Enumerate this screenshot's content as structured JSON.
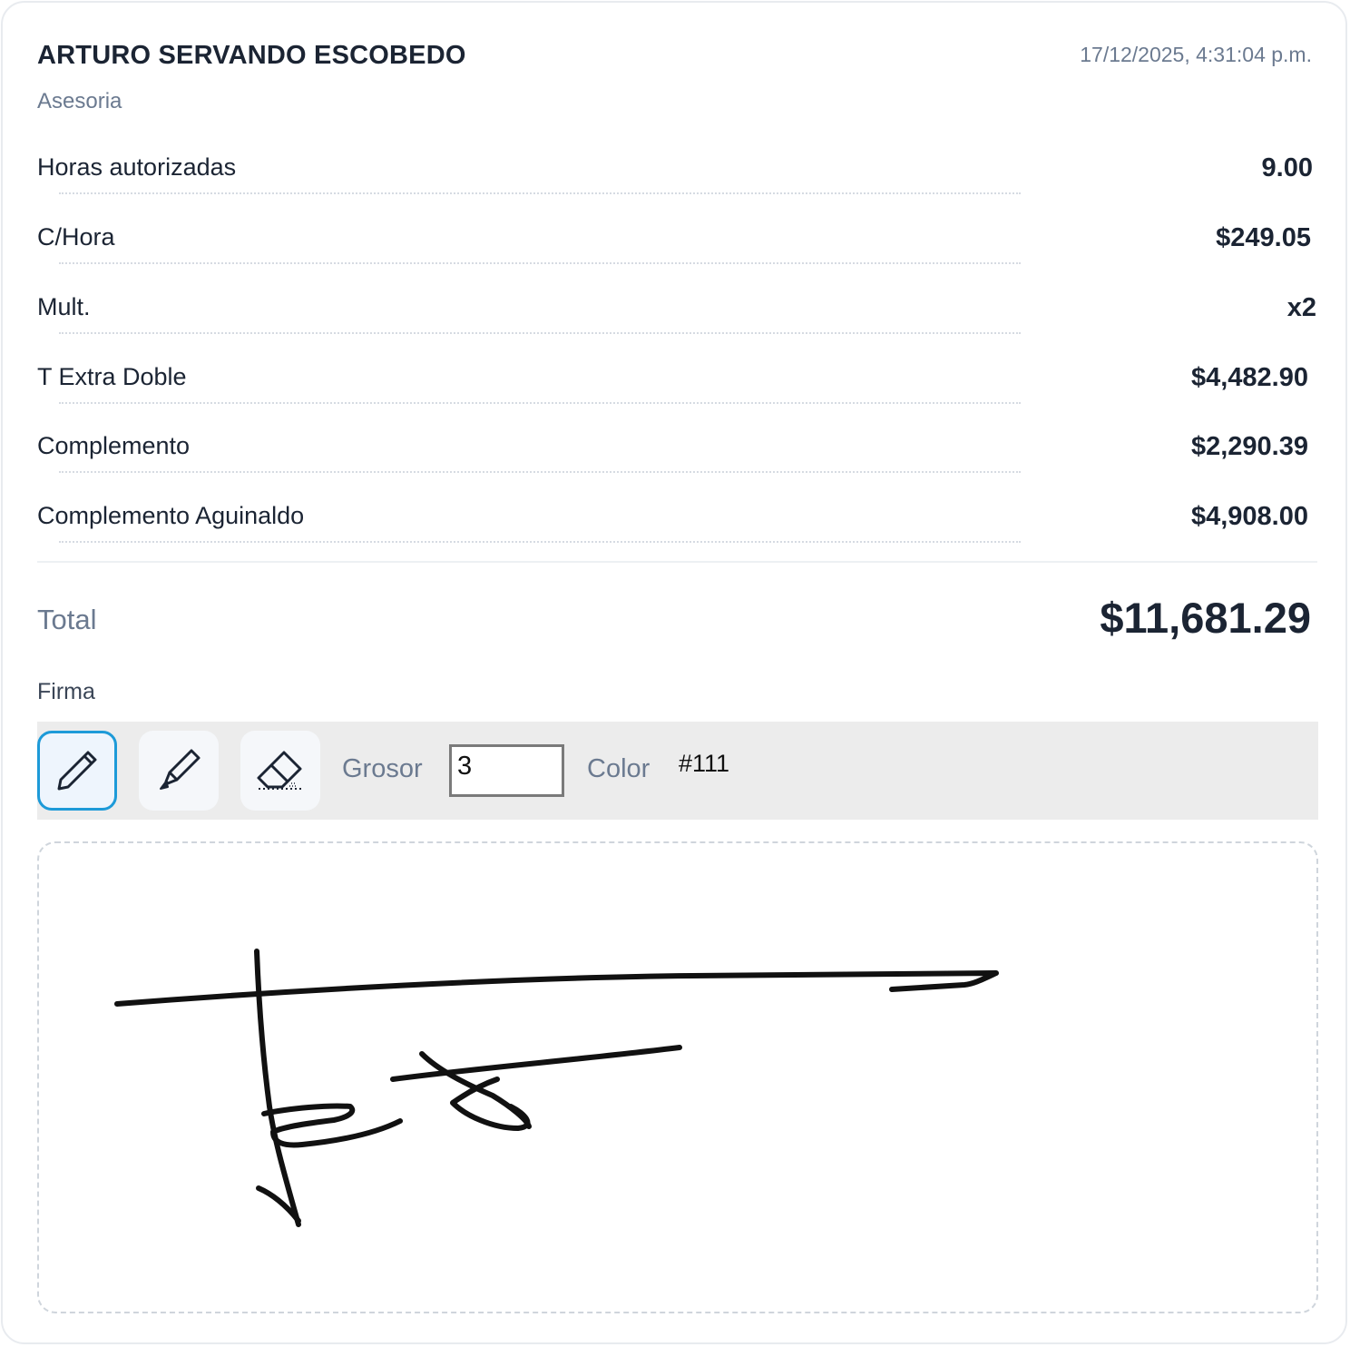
{
  "header": {
    "name": "ARTURO SERVANDO ESCOBEDO",
    "role": "Asesoria",
    "timestamp": "17/12/2025, 4:31:04 p.m."
  },
  "items": [
    {
      "label": "Horas autorizadas",
      "value": "9.00"
    },
    {
      "label": "C/Hora",
      "value": "$249.05"
    },
    {
      "label": "Mult.",
      "value": "x2"
    },
    {
      "label": "T Extra Doble",
      "value": "$4,482.90"
    },
    {
      "label": "Complemento",
      "value": "$2,290.39"
    },
    {
      "label": "Complemento Aguinaldo",
      "value": "$4,908.00"
    }
  ],
  "total": {
    "label": "Total",
    "value": "$11,681.29"
  },
  "signature": {
    "label": "Firma",
    "tools": [
      {
        "icon": "pen-icon",
        "active": true
      },
      {
        "icon": "marker-icon",
        "active": false
      },
      {
        "icon": "eraser-icon",
        "active": false
      }
    ],
    "thickness_label": "Grosor",
    "thickness_value": "3",
    "color_label": "Color",
    "color_value": "#111"
  },
  "colors": {
    "text_primary": "#1b2433",
    "text_muted": "#6b7a90",
    "accent": "#1d9ad8",
    "ink": "#111111"
  }
}
